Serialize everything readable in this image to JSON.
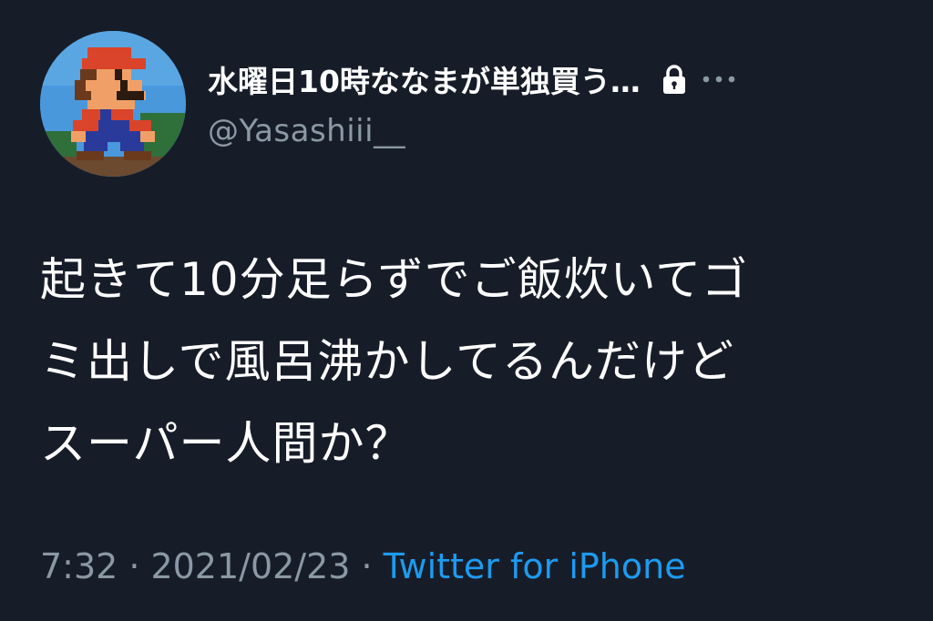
{
  "user": {
    "display_name": "水曜日10時ななまが単独買う…",
    "handle": "@Yasashiii__",
    "avatar_icon": "pixel-mario-avatar",
    "protected_icon": "lock-icon",
    "more_icon": "more-horizontal-icon"
  },
  "tweet": {
    "lines": [
      "起きて10分足らずでご飯炊いてゴ",
      "ミ出しで風呂沸かしてるんだけど",
      "スーパー人間か？"
    ]
  },
  "meta": {
    "time": "7:32",
    "separator": "·",
    "date": "2021/02/23",
    "source": "Twitter for iPhone"
  },
  "colors": {
    "background": "#171d28",
    "primary_text": "#ffffff",
    "secondary_text": "#8b98a5",
    "link": "#1d9bf0"
  }
}
